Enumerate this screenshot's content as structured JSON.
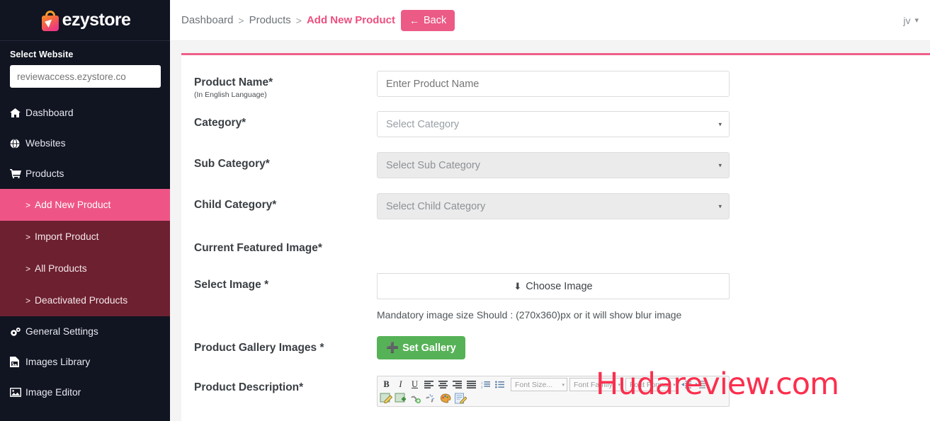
{
  "brand": {
    "name": "ezystore",
    "logo_icon": "shopping-bag-icon"
  },
  "sidebar": {
    "select_website_label": "Select Website",
    "website_value": "reviewaccess.ezystore.co",
    "website_placeholder": "reviewaccess.ezystore.co",
    "items": [
      {
        "label": "Dashboard",
        "icon": "home-icon"
      },
      {
        "label": "Websites",
        "icon": "globe-icon"
      },
      {
        "label": "Products",
        "icon": "cart-icon"
      }
    ],
    "submenu": [
      {
        "label": "Add New Product",
        "active": true
      },
      {
        "label": "Import Product",
        "active": false
      },
      {
        "label": "All Products",
        "active": false
      },
      {
        "label": "Deactivated Products",
        "active": false
      }
    ],
    "bottom_items": [
      {
        "label": "General Settings",
        "icon": "gears-icon"
      },
      {
        "label": "Images Library",
        "icon": "image-file-icon"
      },
      {
        "label": "Image Editor",
        "icon": "picture-icon"
      }
    ],
    "caret": ">"
  },
  "topbar": {
    "breadcrumb": {
      "crumb1": "Dashboard",
      "sep": ">",
      "crumb2": "Products",
      "crumb3": "Add New Product"
    },
    "back_label": "Back",
    "back_arrow": "←",
    "user_initials": "jv",
    "user_caret": "⌄"
  },
  "form": {
    "product_name": {
      "label": "Product Name*",
      "sublabel": "(In English Language)",
      "placeholder": "Enter Product Name",
      "value": ""
    },
    "category": {
      "label": "Category*",
      "selected": "Select Category",
      "caret": "▾"
    },
    "sub_category": {
      "label": "Sub Category*",
      "selected": "Select Sub Category",
      "caret": "▾",
      "disabled": true
    },
    "child_category": {
      "label": "Child Category*",
      "selected": "Select Child Category",
      "caret": "▾",
      "disabled": true
    },
    "current_featured_image": {
      "label": "Current Featured Image*"
    },
    "select_image": {
      "label": "Select Image *",
      "button_label": "Choose Image",
      "button_icon": "download-icon",
      "hint": "Mandatory image size Should : (270x360)px or it will show blur image"
    },
    "gallery": {
      "label": "Product Gallery Images *",
      "button_label": "Set Gallery",
      "button_icon": "plus-icon"
    },
    "description": {
      "label": "Product Description*"
    }
  },
  "editor_toolbar": {
    "row1": [
      {
        "name": "bold-icon",
        "glyph": "B"
      },
      {
        "name": "italic-icon",
        "glyph": "I"
      },
      {
        "name": "underline-icon",
        "glyph": "U"
      },
      {
        "name": "align-left-icon",
        "glyph": ""
      },
      {
        "name": "align-center-icon",
        "glyph": ""
      },
      {
        "name": "align-right-icon",
        "glyph": ""
      },
      {
        "name": "align-justify-icon",
        "glyph": ""
      },
      {
        "name": "ordered-list-icon",
        "glyph": ""
      },
      {
        "name": "unordered-list-icon",
        "glyph": ""
      }
    ],
    "combos": [
      {
        "name": "font-size-select",
        "label": "Font Size..."
      },
      {
        "name": "font-family-select",
        "label": "Font Family:"
      },
      {
        "name": "font-format-select",
        "label": "Font Format"
      }
    ],
    "row1_end": [
      {
        "name": "indent-decrease-icon"
      },
      {
        "name": "indent-increase-icon"
      }
    ],
    "row2": [
      {
        "name": "edit-image-icon"
      },
      {
        "name": "insert-image-icon"
      },
      {
        "name": "insert-link-icon"
      },
      {
        "name": "unlink-icon"
      },
      {
        "name": "text-color-icon"
      },
      {
        "name": "source-edit-icon"
      }
    ]
  },
  "watermark": {
    "text": "Hudareview.com"
  },
  "colors": {
    "sidebar_bg": "#111421",
    "submenu_bg": "#6d2030",
    "accent_pink": "#ee5586",
    "crumb_active": "#ee4f7f",
    "green": "#56b257",
    "watermark": "#fb2f4e"
  }
}
